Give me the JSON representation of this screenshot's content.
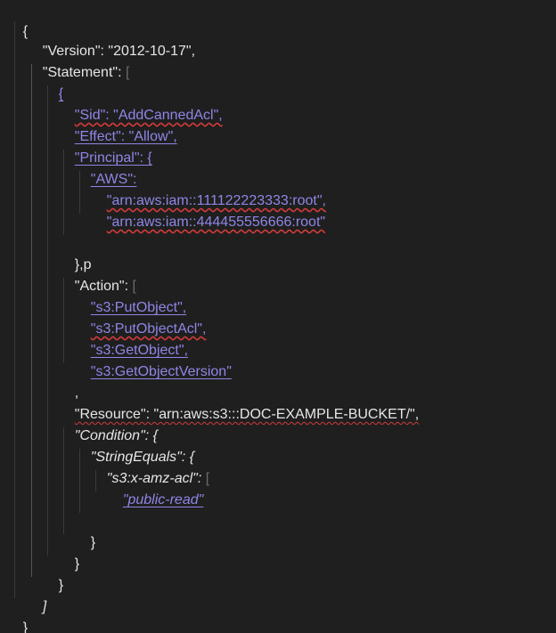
{
  "editor": {
    "theme_colors": {
      "background": "#1f1f1f",
      "text": "#e6e6e6",
      "link": "#8e86e6",
      "bracket_dim": "#6b6b6b",
      "spell_error": "#d23a3a"
    },
    "lines": {
      "l1": "{",
      "l2": "\"Version\": \"2012-10-17\",",
      "l3_key": "\"Statement\": ",
      "l3_bracket": "[",
      "l4": "{",
      "l5": "\"Sid\": \"AddCannedAcl\",",
      "l6": "\"Effect\": \"Allow\",",
      "l7": "\"Principal\": {",
      "l8": "\"AWS\":",
      "l9": "\"arn:aws:iam::111122223333:root\",",
      "l10": "\"arn:aws:iam::444455556666:root\"",
      "l12": "},p",
      "l13_key": "\"Action\": ",
      "l13_bracket": "[",
      "l14": "\"s3:PutObject\",",
      "l15": "\"s3:PutObjectAcl\",",
      "l16": "\"s3:GetObject\",",
      "l17": "\"s3:GetObjectVersion\"",
      "l18": ",",
      "l19": "\"Resource\": \"arn:aws:s3:::DOC-EXAMPLE-BUCKET/\",",
      "l20": "\"Condition\": {",
      "l21": "\"StringEquals\": {",
      "l22_key": "\"s3:x-amz-acl\": ",
      "l22_bracket": "[",
      "l23": "\"public-read\"",
      "l25": "}",
      "l26": "}",
      "l27": "}",
      "l28": "]",
      "l29": "}"
    }
  }
}
